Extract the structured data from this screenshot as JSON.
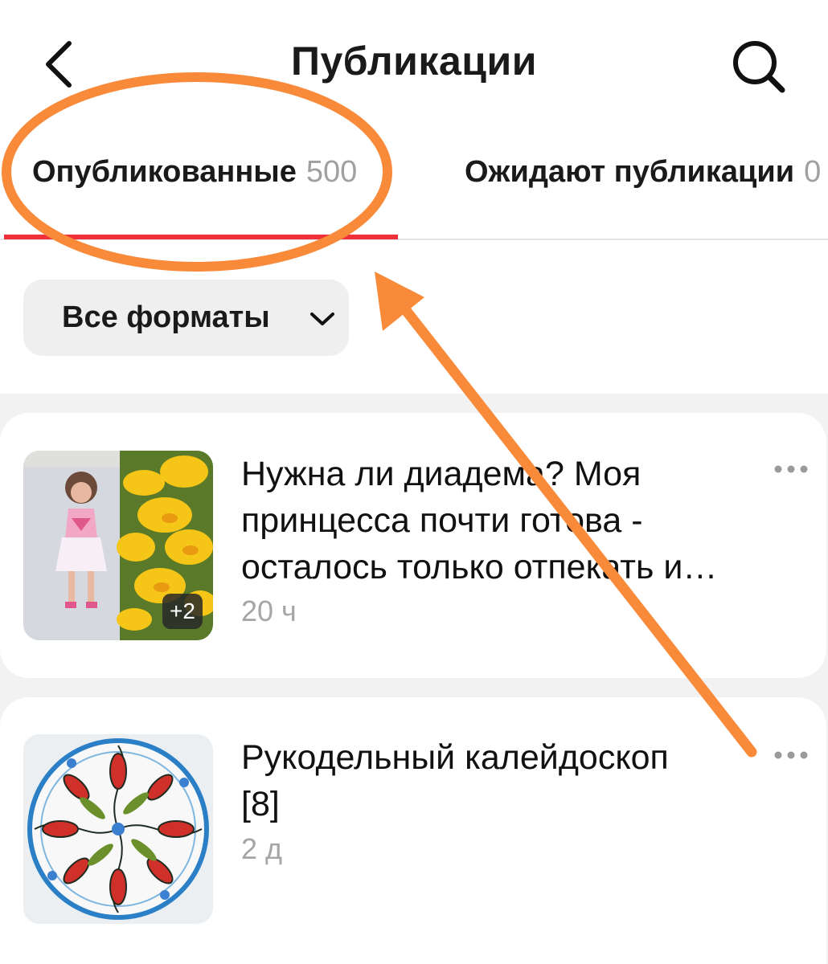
{
  "header": {
    "title": "Публикации",
    "back_icon": "chevron-left-icon",
    "search_icon": "search-icon"
  },
  "tabs": [
    {
      "label": "Опубликованные",
      "count": "500",
      "active": true
    },
    {
      "label": "Ожидают публикации",
      "count": "0",
      "active": false
    }
  ],
  "filter": {
    "label": "Все форматы",
    "icon": "chevron-down-icon"
  },
  "posts": [
    {
      "title_lines": [
        "Нужна ли диадема? Моя",
        "принцесса почти готова -",
        "осталось только отпекать и…"
      ],
      "time": "20 ч",
      "extra_images": "+2",
      "more_icon": "more-horizontal-icon"
    },
    {
      "title_lines": [
        "Рукодельный калейдоскоп",
        "[8]"
      ],
      "time": "2 д",
      "more_icon": "more-horizontal-icon"
    }
  ],
  "colors": {
    "accent": "#f0303a",
    "annotation": "#f88a3a",
    "muted_text": "#a6a6a6",
    "chip_bg": "#efefef",
    "feed_bg": "#f2f2f2"
  }
}
